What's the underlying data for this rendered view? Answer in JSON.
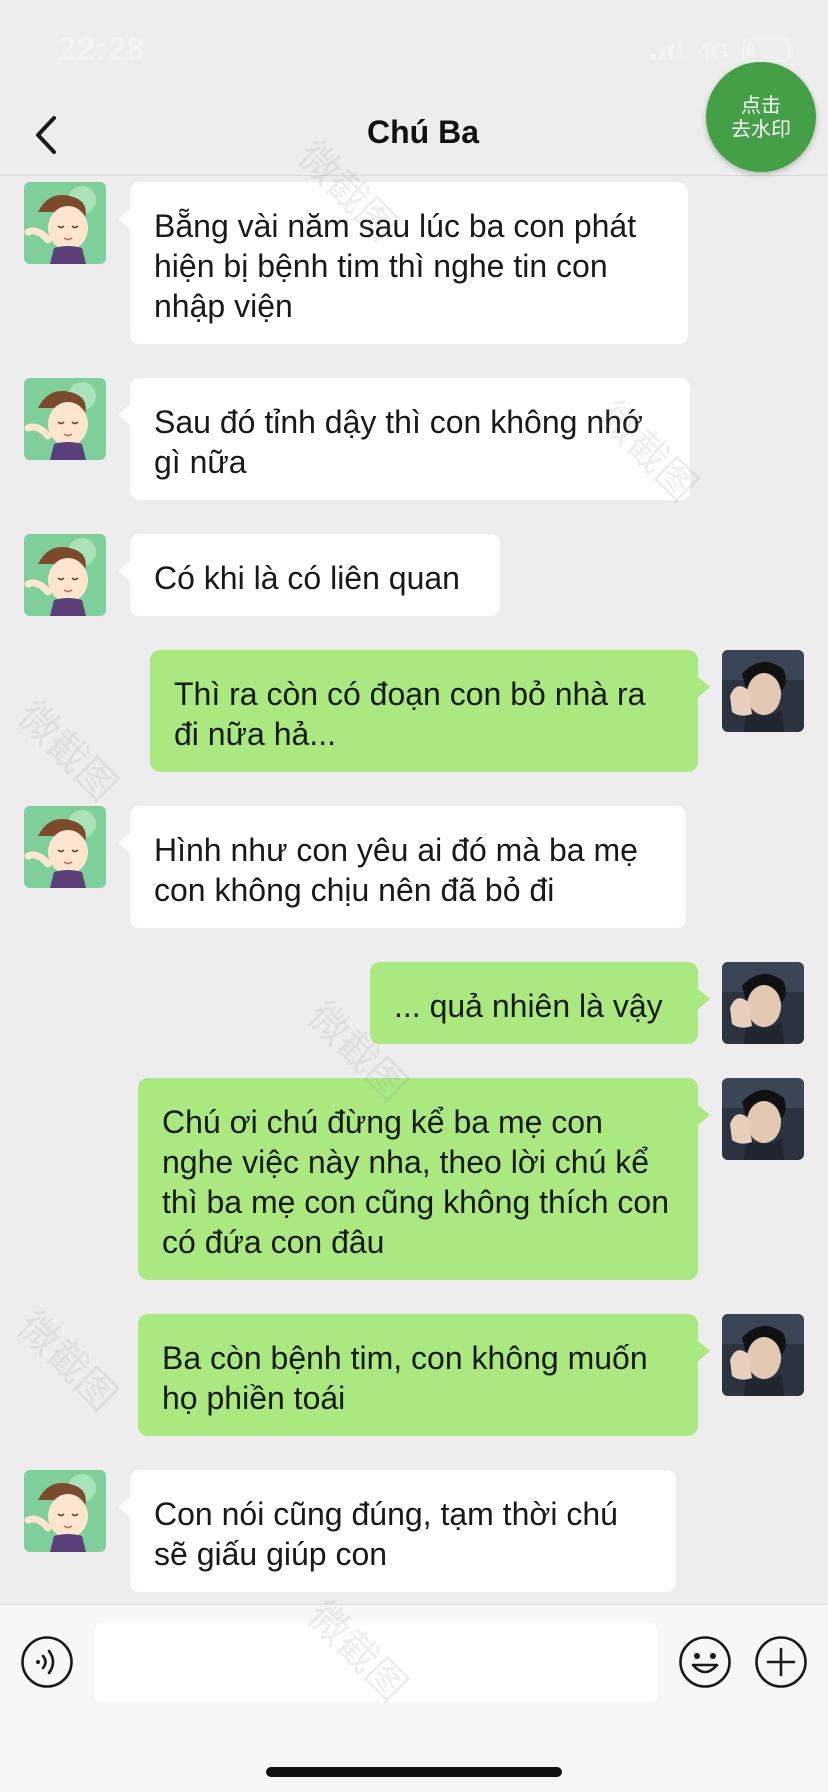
{
  "status_bar": {
    "time": "22:28",
    "network": "4G"
  },
  "header": {
    "back_icon": "chevron-left-icon",
    "title": "Chú Ba"
  },
  "watermark_button": {
    "line1": "点击",
    "line2": "去水印"
  },
  "watermark_text": "微截图",
  "messages": [
    {
      "side": "in",
      "text": "Bẵng vài năm sau lúc ba con phát hiện bị bệnh tim thì nghe tin con nhập viện"
    },
    {
      "side": "in",
      "text": "Sau đó tỉnh dậy thì con không nhớ gì nữa"
    },
    {
      "side": "in",
      "text": "Có khi là có liên quan"
    },
    {
      "side": "out",
      "text": "Thì ra còn có đoạn con bỏ nhà ra đi nữa hả..."
    },
    {
      "side": "in",
      "text": "Hình như con yêu ai đó mà ba mẹ con không chịu nên đã bỏ đi"
    },
    {
      "side": "out",
      "text": "... quả nhiên là vậy"
    },
    {
      "side": "out",
      "text": "Chú ơi chú đừng kể ba mẹ con nghe việc này nha, theo lời chú kể thì ba mẹ con cũng không thích con có đứa con đâu"
    },
    {
      "side": "out",
      "text": "Ba còn bệnh tim, con không muốn họ phiền toái"
    },
    {
      "side": "in",
      "text": "Con nói cũng đúng, tạm thời chú sẽ giấu giúp con"
    }
  ],
  "input_bar": {
    "voice_icon": "voice-icon",
    "emoji_icon": "emoji-icon",
    "plus_icon": "plus-icon",
    "input_value": ""
  },
  "colors": {
    "background": "#ededed",
    "incoming_bubble": "#ffffff",
    "outgoing_bubble": "#a9e97f",
    "watermark_button": "#43a047"
  }
}
